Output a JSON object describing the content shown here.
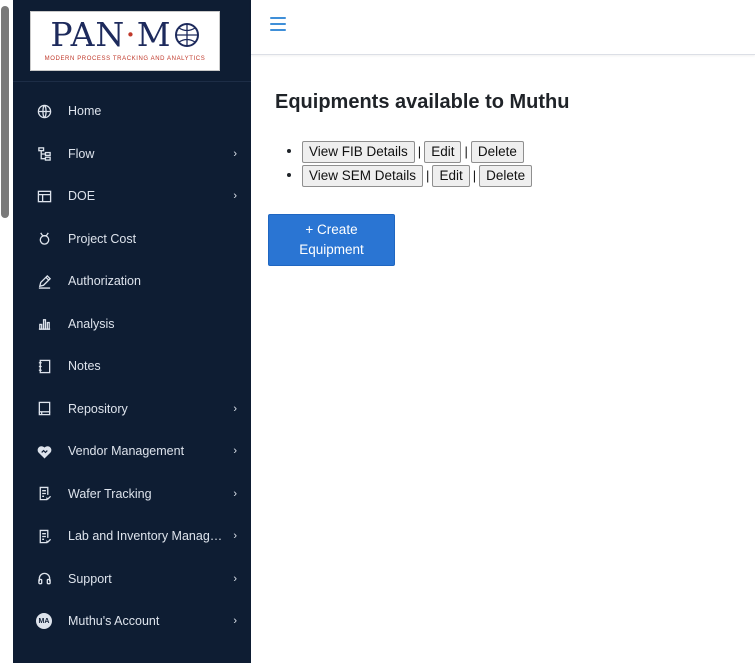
{
  "logo": {
    "main_left": "PAN",
    "main_right": "M",
    "tagline": "MODERN PROCESS TRACKING AND ANALYTICS"
  },
  "sidebar": {
    "items": [
      {
        "label": "Home",
        "icon": "globe-icon",
        "has_submenu": false
      },
      {
        "label": "Flow",
        "icon": "flow-icon",
        "has_submenu": true
      },
      {
        "label": "DOE",
        "icon": "table-icon",
        "has_submenu": true
      },
      {
        "label": "Project Cost",
        "icon": "money-icon",
        "has_submenu": false
      },
      {
        "label": "Authorization",
        "icon": "pen-icon",
        "has_submenu": false
      },
      {
        "label": "Analysis",
        "icon": "bar-chart-icon",
        "has_submenu": false
      },
      {
        "label": "Notes",
        "icon": "notebook-icon",
        "has_submenu": false
      },
      {
        "label": "Repository",
        "icon": "book-icon",
        "has_submenu": true
      },
      {
        "label": "Vendor Management",
        "icon": "heart-handshake-icon",
        "has_submenu": true
      },
      {
        "label": "Wafer Tracking",
        "icon": "document-icon",
        "has_submenu": true
      },
      {
        "label": "Lab and Inventory Management",
        "icon": "document-icon",
        "has_submenu": true
      },
      {
        "label": "Support",
        "icon": "headset-icon",
        "has_submenu": true
      },
      {
        "label": "Muthu's Account",
        "icon": "avatar-icon",
        "avatar_initials": "MA",
        "has_submenu": true
      }
    ],
    "chevron": "›"
  },
  "main": {
    "title": "Equipments available to Muthu",
    "separator": "|",
    "equipments": [
      {
        "view_label": "View FIB Details",
        "edit_label": "Edit",
        "delete_label": "Delete"
      },
      {
        "view_label": "View SEM Details",
        "edit_label": "Edit",
        "delete_label": "Delete"
      }
    ],
    "create_button": "+ Create Equipment"
  },
  "colors": {
    "sidebar_bg": "#0e1d33",
    "accent": "#2a75d3",
    "hamburger": "#3f8fd8",
    "logo_red": "#c0392b",
    "logo_navy": "#1d2a5c"
  }
}
